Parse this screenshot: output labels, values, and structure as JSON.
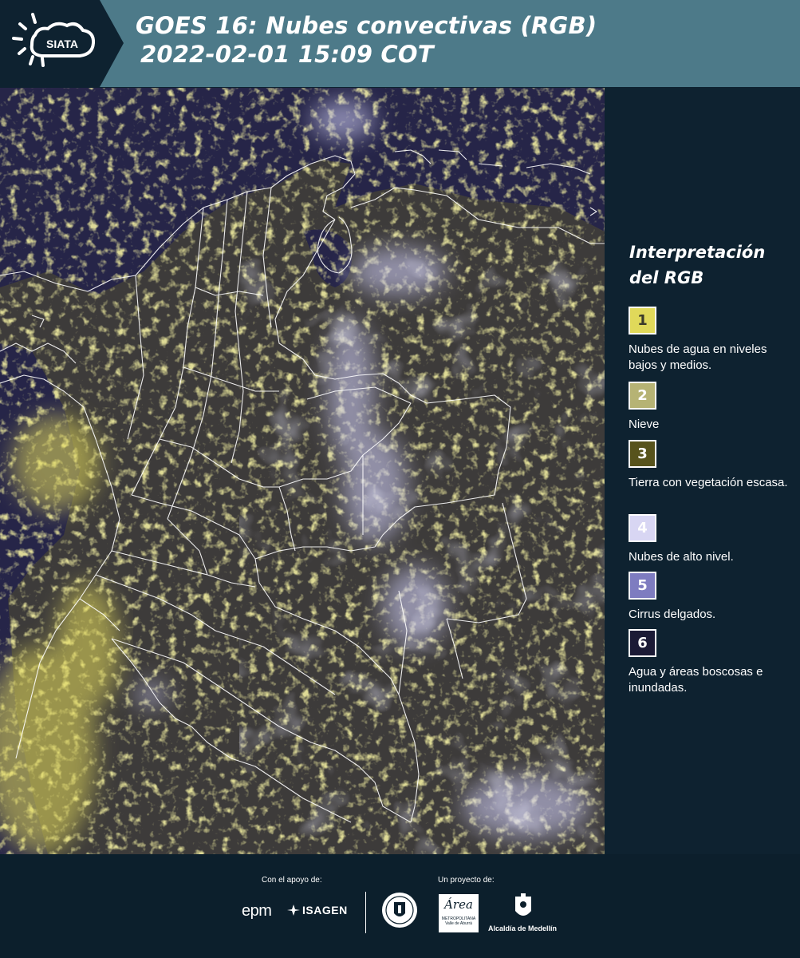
{
  "header": {
    "title_line1": "GOES 16: Nubes convectivas (RGB)",
    "title_line2": "2022-02-01 15:09 COT",
    "logo_text": "SIATA",
    "background_color": "#4d7a89"
  },
  "legend": {
    "title": "Interpretación del RGB",
    "items": [
      {
        "number": "1",
        "label": "Nubes de agua en niveles bajos y medios.",
        "color": "#e0d95a",
        "text_color": "#3a3a2a"
      },
      {
        "number": "2",
        "label": "Nieve",
        "color": "#b6b374",
        "text_color": "#ffffff"
      },
      {
        "number": "3",
        "label": "Tierra con vegetación escasa.",
        "color": "#57531c",
        "text_color": "#ffffff"
      },
      {
        "number": "4",
        "label": "Nubes de alto nivel.",
        "color": "#d8d6f3",
        "text_color": "#ffffff"
      },
      {
        "number": "5",
        "label": "Cirrus delgados.",
        "color": "#7e7cc0",
        "text_color": "#ffffff"
      },
      {
        "number": "6",
        "label": "Agua y áreas boscosas e inundadas.",
        "color": "#1b1a35",
        "text_color": "#ffffff"
      }
    ]
  },
  "footer": {
    "support_label": "Con el apoyo de:",
    "project_label": "Un proyecto de:",
    "sponsor_1": "epm",
    "sponsor_2": "ISAGEN",
    "partner_area": "Área",
    "partner_area_sub": "METROPOLITANA Valle de Aburrá",
    "partner_alcaldia": "Alcaldía de Medellín"
  },
  "map": {
    "background_color": "#262548",
    "cloud_low_color": "#e0d95a",
    "cloud_high_color": "#c9c8ef",
    "land_color": "#4b4a33",
    "border_color": "#ffffff"
  }
}
